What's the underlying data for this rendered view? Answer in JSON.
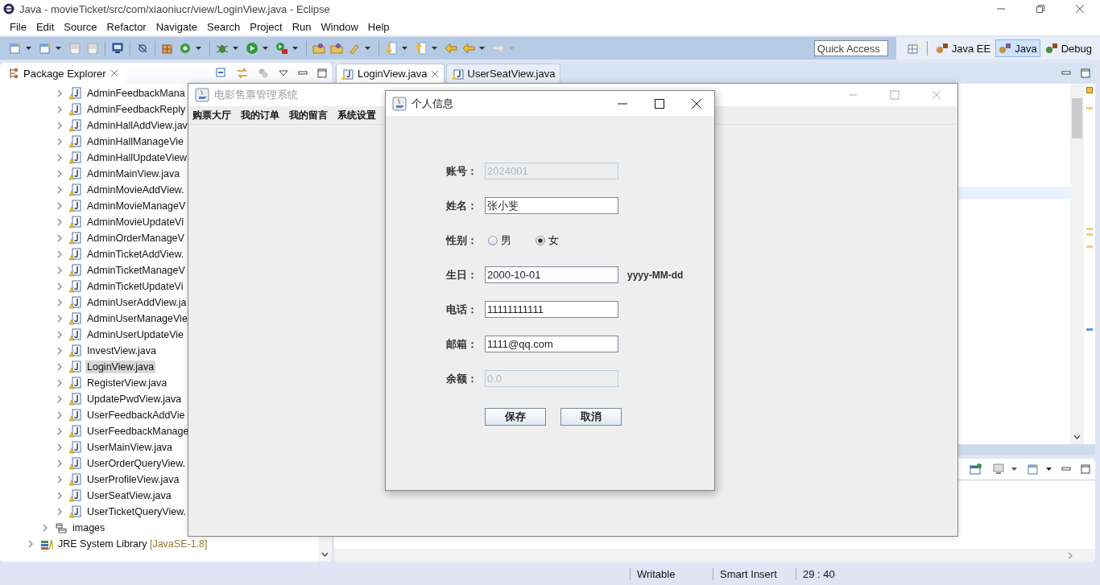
{
  "window": {
    "title": "Java - movieTicket/src/com/xiaoniucr/view/LoginView.java - Eclipse"
  },
  "menu": [
    "File",
    "Edit",
    "Source",
    "Refactor",
    "Navigate",
    "Search",
    "Project",
    "Run",
    "Window",
    "Help"
  ],
  "quick_access": {
    "placeholder": "Quick Access"
  },
  "perspectives": [
    {
      "label": "Java EE",
      "selected": false
    },
    {
      "label": "Java",
      "selected": true
    },
    {
      "label": "Debug",
      "selected": false
    }
  ],
  "package_explorer": {
    "title": "Package Explorer",
    "files": [
      {
        "label": "AdminFeedbackMana",
        "selected": false,
        "expanded": false
      },
      {
        "label": "AdminFeedbackReply",
        "selected": false,
        "expanded": false
      },
      {
        "label": "AdminHallAddView.jav",
        "selected": false,
        "expanded": false
      },
      {
        "label": "AdminHallManageVie",
        "selected": false,
        "expanded": false
      },
      {
        "label": "AdminHallUpdateView",
        "selected": false,
        "expanded": false
      },
      {
        "label": "AdminMainView.java",
        "selected": false,
        "expanded": false
      },
      {
        "label": "AdminMovieAddView.",
        "selected": false,
        "expanded": false
      },
      {
        "label": "AdminMovieManageV",
        "selected": false,
        "expanded": false
      },
      {
        "label": "AdminMovieUpdateVi",
        "selected": false,
        "expanded": false
      },
      {
        "label": "AdminOrderManageV",
        "selected": false,
        "expanded": false
      },
      {
        "label": "AdminTicketAddView.",
        "selected": false,
        "expanded": false
      },
      {
        "label": "AdminTicketManageV",
        "selected": false,
        "expanded": false
      },
      {
        "label": "AdminTicketUpdateVi",
        "selected": false,
        "expanded": false
      },
      {
        "label": "AdminUserAddView.ja",
        "selected": false,
        "expanded": false
      },
      {
        "label": "AdminUserManageVie",
        "selected": false,
        "expanded": false
      },
      {
        "label": "AdminUserUpdateVie",
        "selected": false,
        "expanded": false
      },
      {
        "label": "InvestView.java",
        "selected": false,
        "expanded": false
      },
      {
        "label": "LoginView.java",
        "selected": true,
        "expanded": false
      },
      {
        "label": "RegisterView.java",
        "selected": false,
        "expanded": false
      },
      {
        "label": "UpdatePwdView.java",
        "selected": false,
        "expanded": false
      },
      {
        "label": "UserFeedbackAddVie",
        "selected": false,
        "expanded": false
      },
      {
        "label": "UserFeedbackManage",
        "selected": false,
        "expanded": false
      },
      {
        "label": "UserMainView.java",
        "selected": false,
        "expanded": false
      },
      {
        "label": "UserOrderQueryView.",
        "selected": false,
        "expanded": false
      },
      {
        "label": "UserProfileView.java",
        "selected": false,
        "expanded": false
      },
      {
        "label": "UserSeatView.java",
        "selected": false,
        "expanded": false
      },
      {
        "label": "UserTicketQueryView.",
        "selected": false,
        "expanded": false
      }
    ],
    "folders": [
      {
        "label": "images",
        "expanded": false
      }
    ],
    "libraries": [
      {
        "label": "JRE System Library",
        "decoration": "[JavaSE-1.8]",
        "expanded": false
      }
    ]
  },
  "editor_tabs": [
    {
      "label": "LoginView.java",
      "selected": true
    },
    {
      "label": "UserSeatView.java",
      "selected": false
    }
  ],
  "app_window": {
    "title": "电影售票管理系统",
    "menu": [
      "购票大厅",
      "我的订单",
      "我的留言",
      "系统设置"
    ]
  },
  "dialog": {
    "title": "个人信息",
    "fields": [
      {
        "kind": "text",
        "label": "账号：",
        "value": "2024001",
        "disabled": true
      },
      {
        "kind": "text",
        "label": "姓名：",
        "value": "张小斐",
        "disabled": false
      },
      {
        "kind": "radio",
        "label": "性别：",
        "options": [
          {
            "label": "男",
            "selected": false
          },
          {
            "label": "女",
            "selected": true
          }
        ]
      },
      {
        "kind": "text",
        "label": "生日：",
        "value": "2000-10-01",
        "disabled": false,
        "format_hint": "yyyy-MM-dd"
      },
      {
        "kind": "text",
        "label": "电话：",
        "value": "11111111111",
        "disabled": false
      },
      {
        "kind": "text",
        "label": "邮箱：",
        "value": "1111@qq.com",
        "disabled": false
      },
      {
        "kind": "text",
        "label": "余额：",
        "value": "0.0",
        "disabled": true
      }
    ],
    "buttons": [
      "保存",
      "取消"
    ]
  },
  "status_bar": [
    "Writable",
    "Smart Insert",
    "29 : 40"
  ]
}
